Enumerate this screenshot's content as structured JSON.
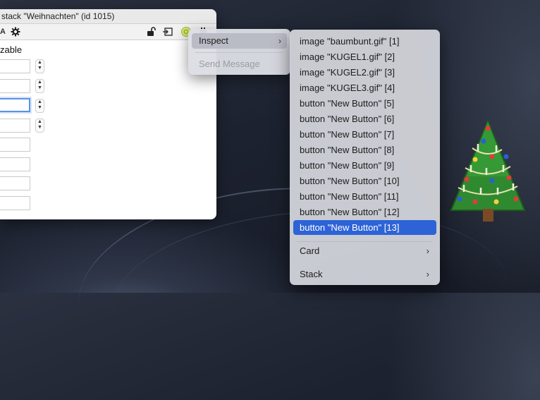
{
  "window": {
    "title": "stack \"Weihnachten\" (id 1015)",
    "section_label": "zable"
  },
  "toolbar_icons": [
    "text-A-icon",
    "gear-icon",
    "lock-icon",
    "message-box-icon",
    "target-icon",
    "plugin-icon"
  ],
  "context_menu": {
    "items": [
      {
        "label": "Inspect",
        "has_submenu": true,
        "highlighted": true
      },
      {
        "label": "Send Message",
        "enabled": false
      }
    ]
  },
  "submenu": {
    "objects": [
      "image \"baumbunt.gif\" [1]",
      "image \"KUGEL1.gif\" [2]",
      "image \"KUGEL2.gif\" [3]",
      "image \"KUGEL3.gif\" [4]",
      "button \"New Button\" [5]",
      "button \"New Button\" [6]",
      "button \"New Button\" [7]",
      "button \"New Button\" [8]",
      "button \"New Button\" [9]",
      "button \"New Button\" [10]",
      "button \"New Button\" [11]",
      "button \"New Button\" [12]",
      "button \"New Button\" [13]"
    ],
    "selected_index": 12,
    "footer_items": [
      {
        "label": "Card",
        "has_submenu": true
      },
      {
        "label": "Stack",
        "has_submenu": true
      }
    ]
  },
  "colors": {
    "selection": "#2d63d7",
    "focus_ring": "#5a92e6",
    "tree_green": "#2f8a2f"
  }
}
